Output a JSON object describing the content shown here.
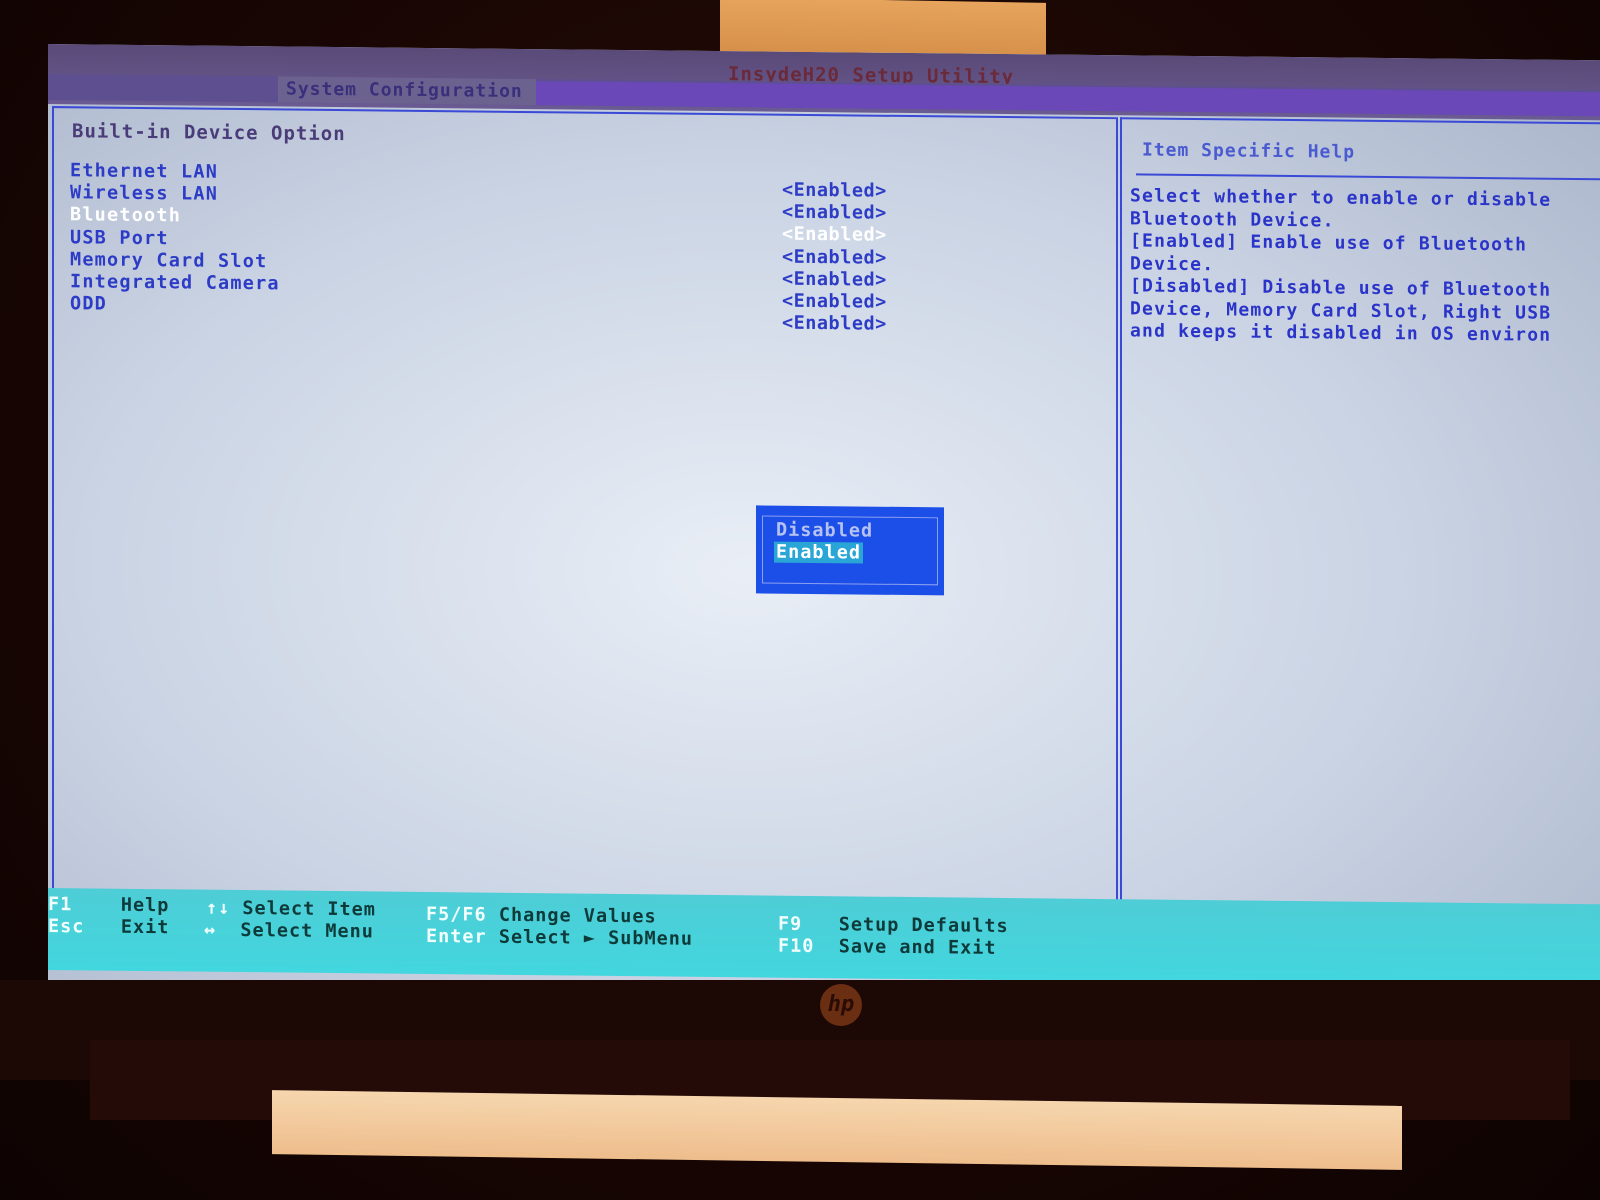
{
  "app": {
    "title": "InsydeH20 Setup Utility",
    "active_menu": "System Configuration"
  },
  "main": {
    "section_title": "Built-in Device Option",
    "options": [
      {
        "label": "Ethernet LAN",
        "value": "<Enabled>",
        "selected": false
      },
      {
        "label": "Wireless LAN",
        "value": "<Enabled>",
        "selected": false
      },
      {
        "label": "Bluetooth",
        "value": "<Enabled>",
        "selected": true
      },
      {
        "label": "USB Port",
        "value": "<Enabled>",
        "selected": false
      },
      {
        "label": "Memory Card Slot",
        "value": "<Enabled>",
        "selected": false
      },
      {
        "label": "Integrated Camera",
        "value": "<Enabled>",
        "selected": false
      },
      {
        "label": "ODD",
        "value": "<Enabled>",
        "selected": false
      }
    ]
  },
  "popup": {
    "options": [
      "Disabled",
      "Enabled"
    ],
    "highlighted": "Enabled"
  },
  "help": {
    "title": "Item Specific Help",
    "lines": [
      "Select whether to enable or disable",
      "Bluetooth Device.",
      "[Enabled] Enable use of Bluetooth",
      "Device.",
      "[Disabled] Disable use of Bluetooth",
      "Device, Memory Card Slot, Right USB",
      "and keeps it disabled in OS environ"
    ]
  },
  "footer": {
    "keys": [
      {
        "key": "F1",
        "desc": "Help"
      },
      {
        "key": "Esc",
        "desc": "Exit"
      },
      {
        "key": "↑↓",
        "desc": "Select Item"
      },
      {
        "key": "↔",
        "desc": "Select Menu"
      },
      {
        "key": "F5/F6",
        "desc": "Change Values"
      },
      {
        "key": "Enter",
        "desc": "Select ► SubMenu"
      },
      {
        "key": "F9",
        "desc": "Setup Defaults"
      },
      {
        "key": "F10",
        "desc": "Save and Exit"
      }
    ]
  },
  "device": {
    "brand_logo": "hp"
  },
  "colors": {
    "background": "#c9d3e3",
    "item_text": "#2d3cc6",
    "selected_text": "#ffffff",
    "popup_bg": "#1c4ee8",
    "popup_highlight": "#2aa6d6",
    "footer_bg": "#4ecdd6",
    "border": "#3a49d6"
  }
}
